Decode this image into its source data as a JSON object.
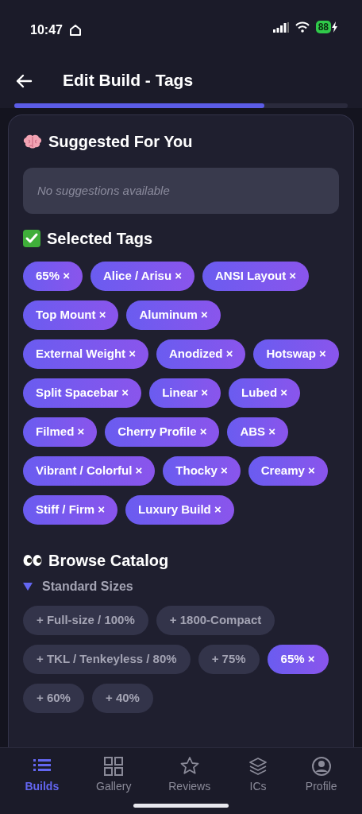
{
  "status_bar": {
    "time": "10:47",
    "battery": "88"
  },
  "header": {
    "title": "Edit Build - Tags"
  },
  "progress": {
    "level": 0.75
  },
  "suggested": {
    "title": "Suggested For You",
    "empty_text": "No suggestions available"
  },
  "selected_tags": {
    "title": "Selected Tags",
    "tags": [
      {
        "label": "65% ×"
      },
      {
        "label": "Alice / Arisu ×"
      },
      {
        "label": "ANSI Layout ×"
      },
      {
        "label": "Top Mount ×"
      },
      {
        "label": "Aluminum ×"
      },
      {
        "label": "External Weight ×"
      },
      {
        "label": "Anodized ×"
      },
      {
        "label": "Hotswap ×"
      },
      {
        "label": "Split Spacebar ×"
      },
      {
        "label": "Linear ×"
      },
      {
        "label": "Lubed ×"
      },
      {
        "label": "Filmed ×"
      },
      {
        "label": "Cherry Profile ×"
      },
      {
        "label": "ABS ×"
      },
      {
        "label": "Vibrant / Colorful ×"
      },
      {
        "label": "Thocky ×"
      },
      {
        "label": "Creamy ×"
      },
      {
        "label": "Stiff / Firm ×"
      },
      {
        "label": "Luxury Build ×"
      }
    ]
  },
  "catalog": {
    "title": "Browse Catalog",
    "group": {
      "label": "Standard Sizes",
      "expanded": true,
      "chips": [
        {
          "label": "+ Full-size / 100%",
          "selected": false
        },
        {
          "label": "+ 1800-Compact",
          "selected": false
        },
        {
          "label": "+ TKL / Tenkeyless / 80%",
          "selected": false
        },
        {
          "label": "+ 75%",
          "selected": false
        },
        {
          "label": "65% ×",
          "selected": true
        },
        {
          "label": "+ 60%",
          "selected": false
        },
        {
          "label": "+ 40%",
          "selected": false
        }
      ]
    }
  },
  "tab_bar": [
    {
      "label": "Builds",
      "selected": true
    },
    {
      "label": "Gallery",
      "selected": false
    },
    {
      "label": "Reviews",
      "selected": false
    },
    {
      "label": "ICs",
      "selected": false
    },
    {
      "label": "Profile",
      "selected": false
    }
  ]
}
